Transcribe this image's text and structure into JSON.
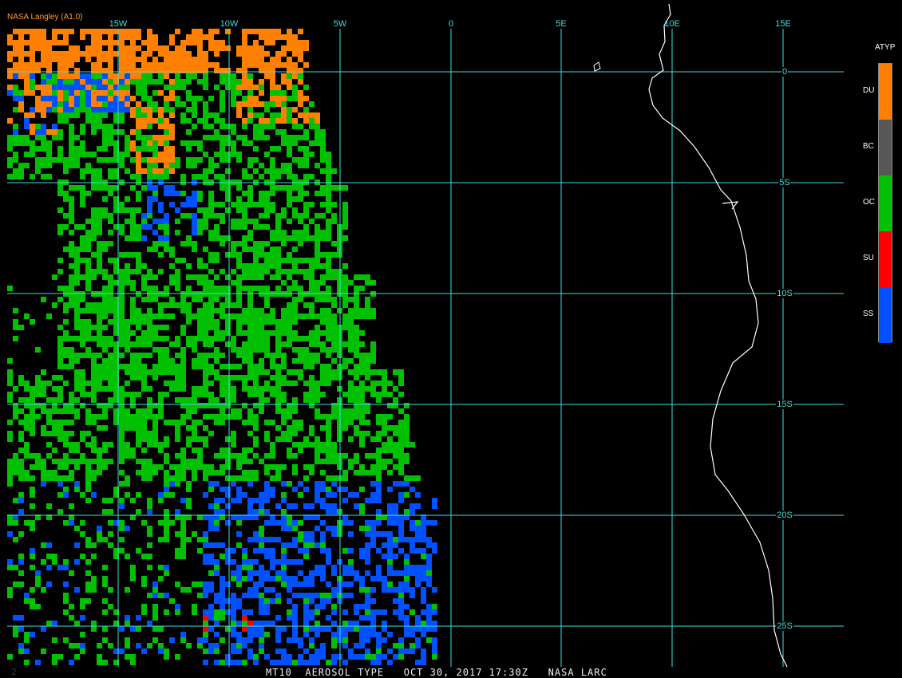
{
  "header": {
    "source_label": "NASA Langley (A1.0)"
  },
  "map": {
    "lon_labels": [
      "15W",
      "10W",
      "5W",
      "0",
      "5E",
      "10E",
      "15E"
    ],
    "lat_labels": [
      "0",
      "5S",
      "10S",
      "15S",
      "20S",
      "25S"
    ],
    "grid_color": "#3fdede",
    "coast_color": "#ffffff"
  },
  "legend": {
    "title": "ATYP",
    "items": [
      {
        "label": "DU",
        "color": "#ff7f00"
      },
      {
        "label": "BC",
        "color": "#575757"
      },
      {
        "label": "OC",
        "color": "#00c000"
      },
      {
        "label": "SU",
        "color": "#ff0000"
      },
      {
        "label": "SS",
        "color": "#0050ff"
      }
    ]
  },
  "status": {
    "left_mark": "2",
    "text": "MT10  AEROSOL TYPE   OCT 30, 2017 17:30Z   NASA LARC"
  }
}
